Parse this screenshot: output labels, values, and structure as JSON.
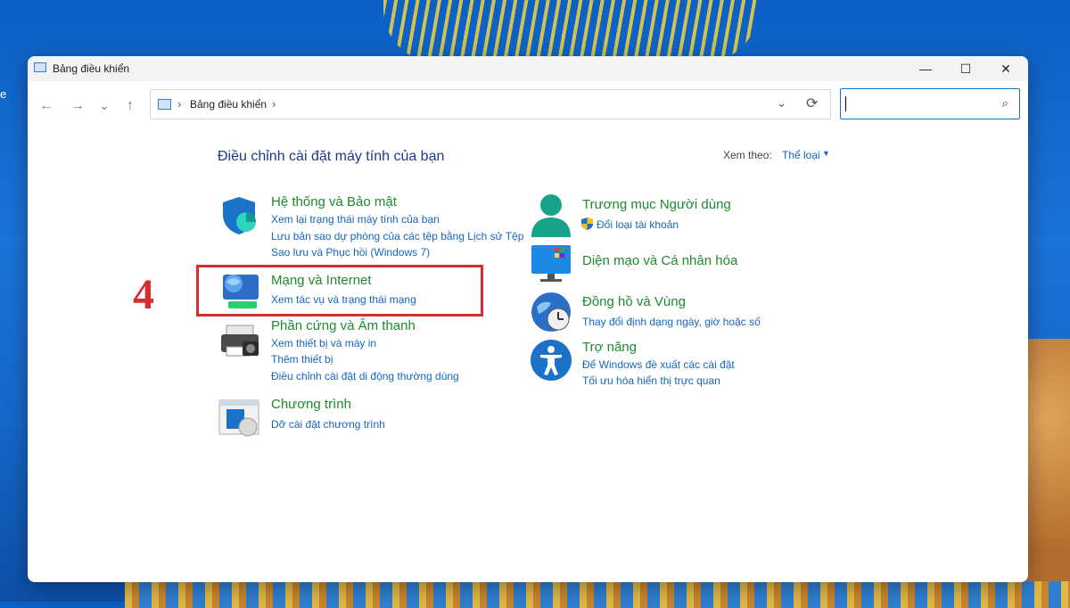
{
  "window": {
    "title": "Bảng điều khiển"
  },
  "desktop": {
    "edge_text": "e"
  },
  "nav": {
    "back": "←",
    "forward": "→",
    "recent": "⌄",
    "up": "↑",
    "breadcrumb": "Bảng điều khiển",
    "sep": "›",
    "dropdown": "⌄",
    "refresh": "⟳",
    "search_placeholder": ""
  },
  "content": {
    "heading": "Điều chỉnh cài đặt máy tính của bạn",
    "view_by_label": "Xem theo:",
    "view_by_value": "Thể loại"
  },
  "left_categories": [
    {
      "title": "Hệ thống và Bảo mật",
      "icon": "shield-icon",
      "links": [
        "Xem lại trạng thái máy tính của bạn",
        "Lưu bản sao dự phòng của các tệp bằng Lịch sử Tệp",
        "Sao lưu và Phục hồi (Windows 7)"
      ]
    },
    {
      "title": "Mạng và Internet",
      "icon": "network-globe-icon",
      "links": [
        "Xem tác vụ và trạng thái mạng"
      ]
    },
    {
      "title": "Phần cứng và Âm thanh",
      "icon": "printer-icon",
      "links": [
        "Xem thiết bị và máy in",
        "Thêm thiết bị",
        "Điều chỉnh cài đặt di động thường dùng"
      ]
    },
    {
      "title": "Chương trình",
      "icon": "programs-icon",
      "links": [
        "Dỡ cài đặt chương trình"
      ]
    }
  ],
  "right_categories": [
    {
      "title": "Trương mục Người dùng",
      "icon": "user-icon",
      "links": [
        "Đổi loại tài khoản"
      ]
    },
    {
      "title": "Diện mạo và Cá nhân hóa",
      "icon": "monitor-icon",
      "links": []
    },
    {
      "title": "Đồng hồ và Vùng",
      "icon": "clock-globe-icon",
      "links": [
        "Thay đổi định dạng ngày, giờ hoặc số"
      ]
    },
    {
      "title": "Trợ năng",
      "icon": "accessibility-icon",
      "links": [
        "Để Windows đề xuất các cài đặt",
        "Tối ưu hóa hiển thị trực quan"
      ]
    }
  ],
  "annotation": {
    "step_number": "4",
    "color": "#d32f2f"
  }
}
